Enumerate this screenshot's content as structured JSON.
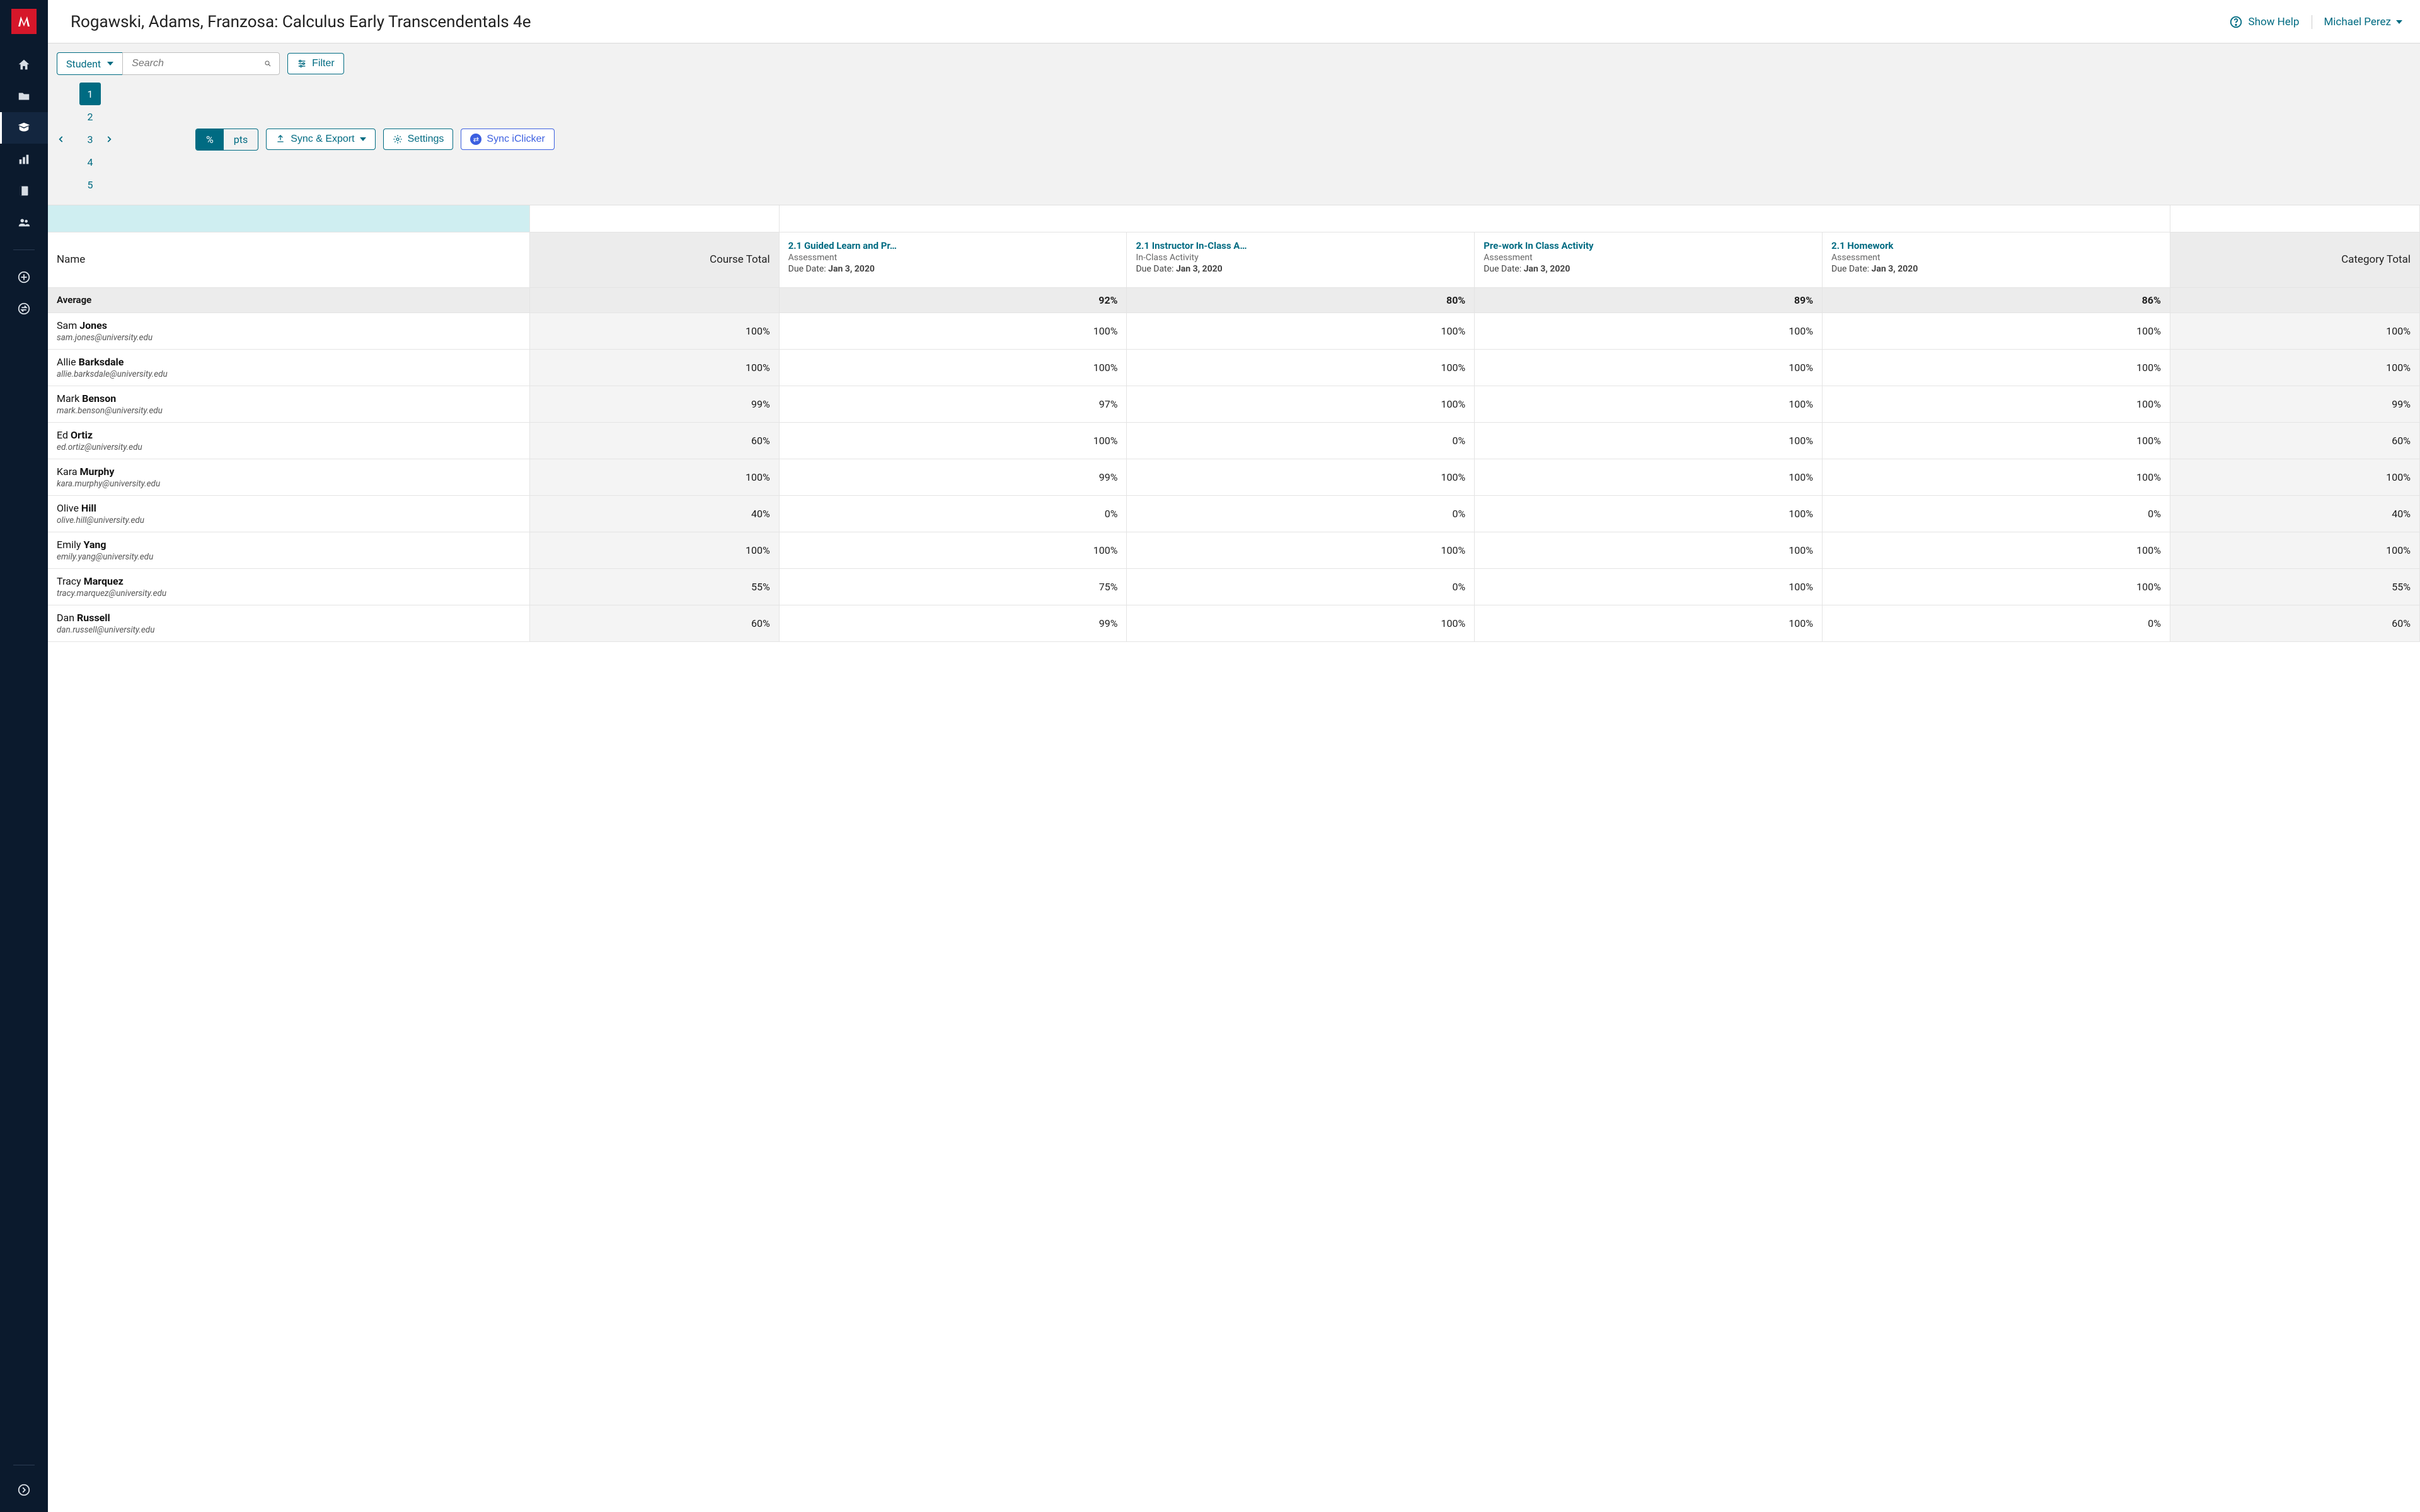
{
  "header": {
    "title": "Rogawski, Adams, Franzosa: Calculus Early Transcendentals 4e",
    "help_label": "Show Help",
    "user_name": "Michael Perez"
  },
  "toolbar": {
    "student_label": "Student",
    "search_placeholder": "Search",
    "filter_label": "Filter",
    "pages": [
      "1",
      "2",
      "3",
      "4",
      "5"
    ],
    "current_page": "1",
    "mode": {
      "percent": "%",
      "points": "pts"
    },
    "sync_export": "Sync & Export",
    "settings": "Settings",
    "sync_iclicker": "Sync iClicker"
  },
  "columns": {
    "name": "Name",
    "course_total": "Course Total",
    "category_total": "Category Total",
    "due_prefix": "Due Date:",
    "assignments": [
      {
        "title": "2.1 Guided Learn and Pr…",
        "type": "Assessment",
        "due": "Jan 3, 2020"
      },
      {
        "title": "2.1 Instructor In-Class A…",
        "type": "In-Class Activity",
        "due": "Jan 3, 2020"
      },
      {
        "title": "Pre-work In Class Activity",
        "type": "Assessment",
        "due": "Jan 3, 2020"
      },
      {
        "title": "2.1 Homework",
        "type": "Assessment",
        "due": "Jan 3, 2020"
      }
    ]
  },
  "average": {
    "label": "Average",
    "values": [
      "92%",
      "80%",
      "89%",
      "86%"
    ]
  },
  "students": [
    {
      "first": "Sam",
      "last": "Jones",
      "email": "sam.jones@university.edu",
      "course_total": "100%",
      "scores": [
        "100%",
        "100%",
        "100%",
        "100%"
      ],
      "cat_total": "100%"
    },
    {
      "first": "Allie",
      "last": "Barksdale",
      "email": "allie.barksdale@university.edu",
      "course_total": "100%",
      "scores": [
        "100%",
        "100%",
        "100%",
        "100%"
      ],
      "cat_total": "100%"
    },
    {
      "first": "Mark",
      "last": "Benson",
      "email": "mark.benson@university.edu",
      "course_total": "99%",
      "scores": [
        "97%",
        "100%",
        "100%",
        "100%"
      ],
      "cat_total": "99%"
    },
    {
      "first": "Ed",
      "last": "Ortiz",
      "email": "ed.ortiz@university.edu",
      "course_total": "60%",
      "scores": [
        "100%",
        "0%",
        "100%",
        "100%"
      ],
      "cat_total": "60%"
    },
    {
      "first": "Kara",
      "last": "Murphy",
      "email": "kara.murphy@university.edu",
      "course_total": "100%",
      "scores": [
        "99%",
        "100%",
        "100%",
        "100%"
      ],
      "cat_total": "100%"
    },
    {
      "first": "Olive",
      "last": "Hill",
      "email": "olive.hill@university.edu",
      "course_total": "40%",
      "scores": [
        "0%",
        "0%",
        "100%",
        "0%"
      ],
      "cat_total": "40%"
    },
    {
      "first": "Emily",
      "last": "Yang",
      "email": "emily.yang@university.edu",
      "course_total": "100%",
      "scores": [
        "100%",
        "100%",
        "100%",
        "100%"
      ],
      "cat_total": "100%"
    },
    {
      "first": "Tracy",
      "last": "Marquez",
      "email": "tracy.marquez@university.edu",
      "course_total": "55%",
      "scores": [
        "75%",
        "0%",
        "100%",
        "100%"
      ],
      "cat_total": "55%"
    },
    {
      "first": "Dan",
      "last": "Russell",
      "email": "dan.russell@university.edu",
      "course_total": "60%",
      "scores": [
        "99%",
        "100%",
        "100%",
        "0%"
      ],
      "cat_total": "60%"
    }
  ]
}
